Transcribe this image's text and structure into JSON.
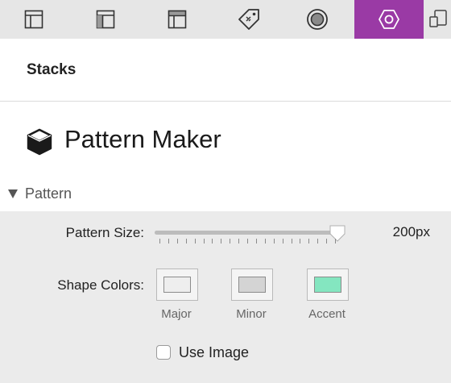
{
  "toolbar": {
    "buttons": [
      {
        "icon": "layout-icon"
      },
      {
        "icon": "layout-sidebar-icon"
      },
      {
        "icon": "layout-header-icon"
      },
      {
        "icon": "tag-icon"
      },
      {
        "icon": "circle-record-icon"
      },
      {
        "icon": "hexagon-settings-icon",
        "active": true
      },
      {
        "icon": "device-preview-icon"
      }
    ],
    "active_color": "#9a3aa5"
  },
  "stacks": {
    "label": "Stacks"
  },
  "header": {
    "title": "Pattern Maker",
    "icon": "cube-icon"
  },
  "section": {
    "label": "Pattern",
    "expanded": true
  },
  "pattern_size": {
    "label": "Pattern Size:",
    "value": "200px",
    "fraction": 0.96
  },
  "shape_colors": {
    "label": "Shape Colors:",
    "swatches": [
      {
        "label": "Major",
        "color": "#eeeeee"
      },
      {
        "label": "Minor",
        "color": "#d4d4d4"
      },
      {
        "label": "Accent",
        "color": "#84e6c0"
      }
    ]
  },
  "use_image": {
    "label": "Use Image",
    "checked": false
  }
}
